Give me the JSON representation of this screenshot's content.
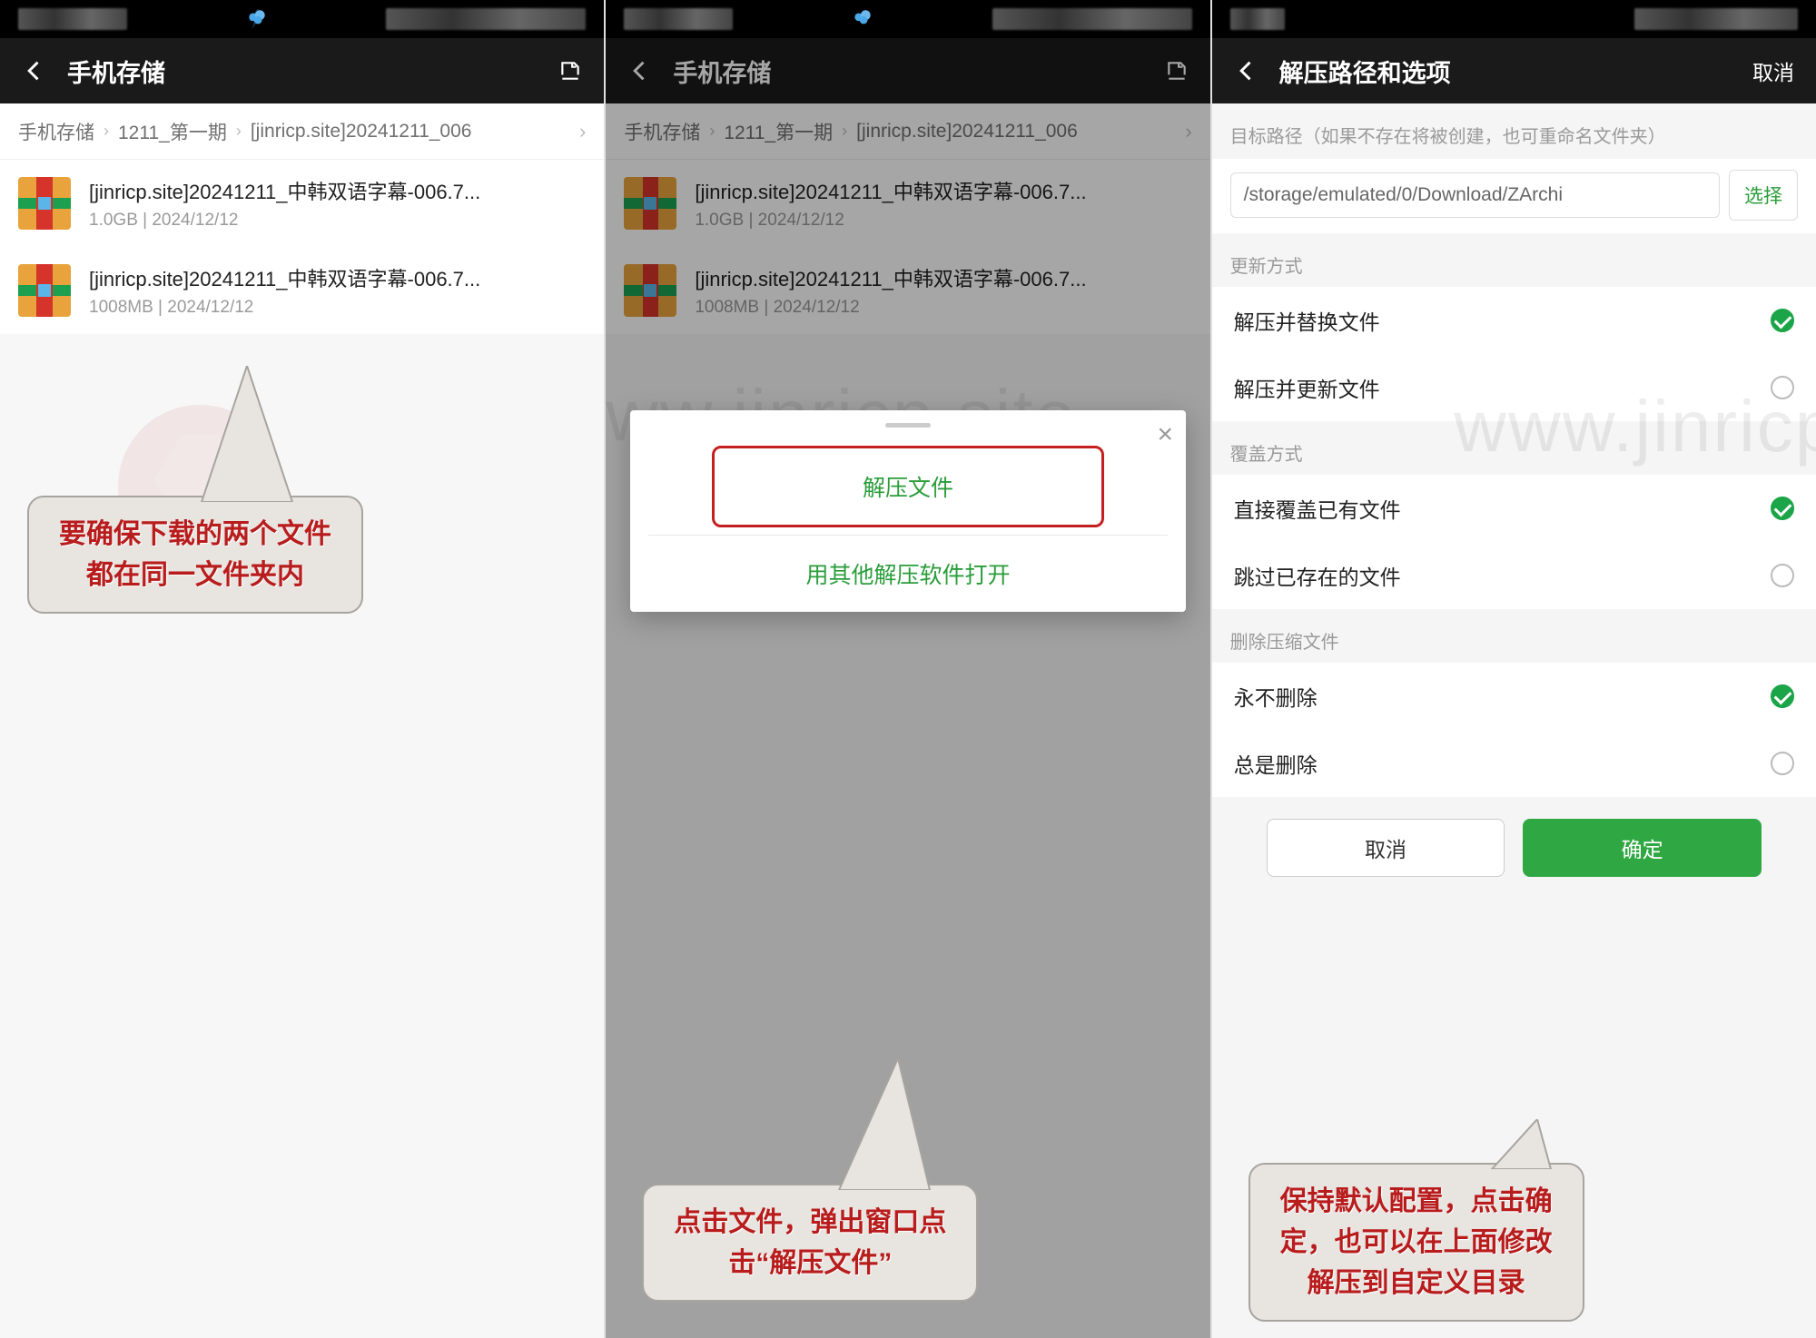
{
  "screen1": {
    "title": "手机存储",
    "breadcrumb": [
      "手机存储",
      "1211_第一期",
      "[jinricp.site]20241211_006"
    ],
    "files": [
      {
        "name": "[jinricp.site]20241211_中韩双语字幕-006.7...",
        "meta": "1.0GB | 2024/12/12"
      },
      {
        "name": "[jinricp.site]20241211_中韩双语字幕-006.7...",
        "meta": "1008MB | 2024/12/12"
      }
    ],
    "callout": "要确保下载的两个文件\n都在同一文件夹内"
  },
  "screen2": {
    "title": "手机存储",
    "breadcrumb": [
      "手机存储",
      "1211_第一期",
      "[jinricp.site]20241211_006"
    ],
    "files": [
      {
        "name": "[jinricp.site]20241211_中韩双语字幕-006.7...",
        "meta": "1.0GB | 2024/12/12"
      },
      {
        "name": "[jinricp.site]20241211_中韩双语字幕-006.7...",
        "meta": "1008MB | 2024/12/12"
      }
    ],
    "popup": {
      "opt1": "解压文件",
      "opt2": "用其他解压软件打开"
    },
    "callout": "点击文件，弹出窗口点\n击“解压文件”"
  },
  "screen3": {
    "title": "解压路径和选项",
    "cancel": "取消",
    "path_hint": "目标路径（如果不存在将被创建，也可重命名文件夹）",
    "path_value": "/storage/emulated/0/Download/ZArchi",
    "select_btn": "选择",
    "sec_update": "更新方式",
    "opt_update1": "解压并替换文件",
    "opt_update2": "解压并更新文件",
    "sec_overwrite": "覆盖方式",
    "opt_ow1": "直接覆盖已有文件",
    "opt_ow2": "跳过已存在的文件",
    "sec_delete": "删除压缩文件",
    "opt_del1": "永不删除",
    "opt_del2": "总是删除",
    "btn_cancel": "取消",
    "btn_ok": "确定",
    "callout": "保持默认配置，点击确\n定，也可以在上面修改\n解压到自定义目录"
  },
  "watermark": "www.jinricp.site"
}
